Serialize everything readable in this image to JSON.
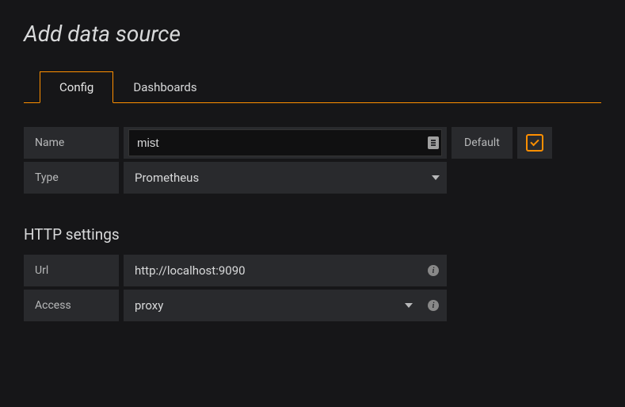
{
  "page_title": "Add data source",
  "tabs": {
    "config": "Config",
    "dashboards": "Dashboards",
    "active": "config"
  },
  "form": {
    "name_label": "Name",
    "name_value": "mist",
    "default_label": "Default",
    "default_checked": true,
    "type_label": "Type",
    "type_value": "Prometheus"
  },
  "http": {
    "section": "HTTP settings",
    "url_label": "Url",
    "url_value": "http://localhost:9090",
    "access_label": "Access",
    "access_value": "proxy"
  }
}
